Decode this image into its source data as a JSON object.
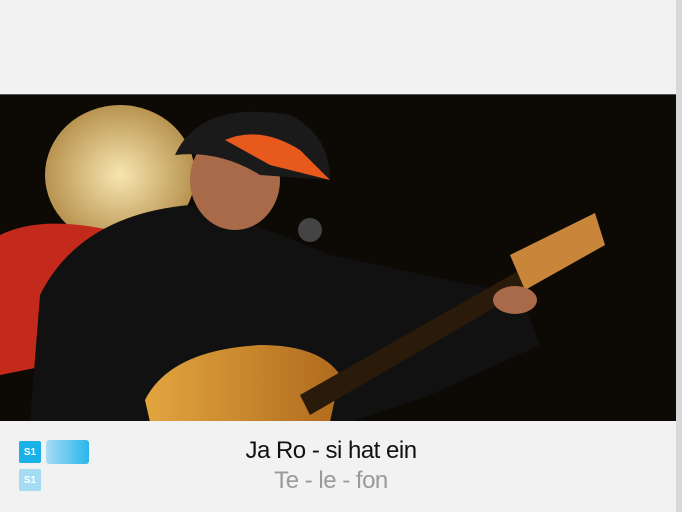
{
  "player": {
    "label": "S1",
    "color": "#1ab0e8"
  },
  "lyrics": {
    "current_line": "Ja Ro - si hat ein",
    "next_line": "Te - le - fon"
  }
}
